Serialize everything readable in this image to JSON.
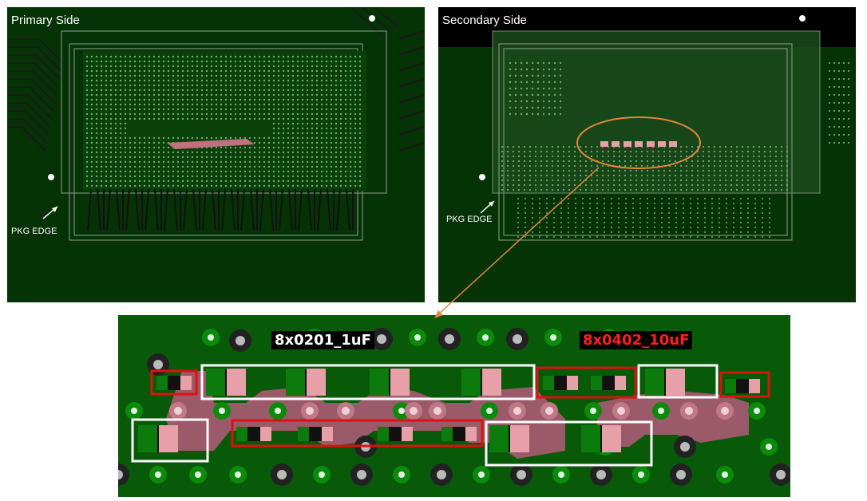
{
  "primary": {
    "title": "Primary Side",
    "pkg_label": "PKG EDGE"
  },
  "secondary": {
    "title": "Secondary Side",
    "pkg_label": "PKG EDGE"
  },
  "zoom": {
    "label_0201": "8x0201_1uF",
    "label_0402": "8x0402_10uF"
  },
  "colors": {
    "board": "#063306",
    "zoom_board": "#085a08",
    "highlight": "#e08840",
    "red_box": "#e01010",
    "white_box": "#ffffff",
    "pad": "#e8a0a8",
    "copper": "#a06070"
  }
}
